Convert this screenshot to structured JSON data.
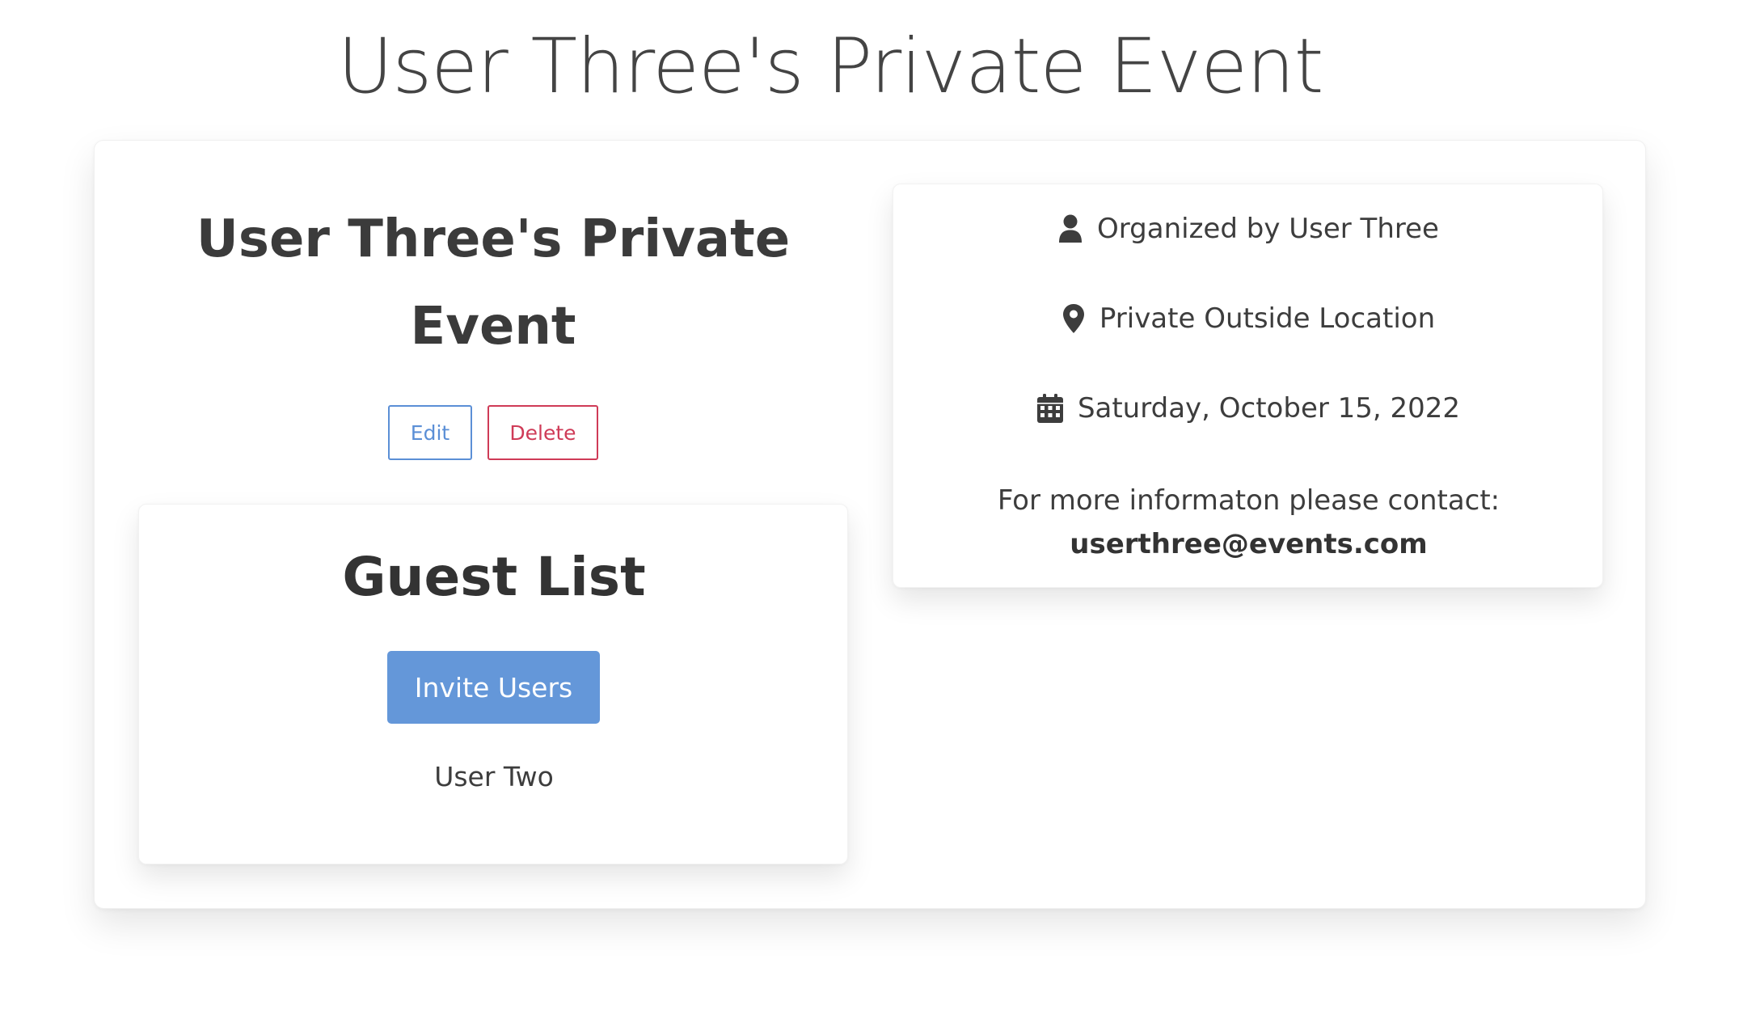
{
  "page": {
    "title": "User Three's Private Event"
  },
  "event": {
    "title": "User Three's Private Event",
    "edit_label": "Edit",
    "delete_label": "Delete"
  },
  "guest_list": {
    "heading": "Guest List",
    "invite_label": "Invite Users",
    "guests": [
      "User Two"
    ]
  },
  "details": {
    "organizer": "Organized by User Three",
    "organizer_icon": "user-icon",
    "location": "Private Outside Location",
    "location_icon": "map-marker-icon",
    "date": "Saturday, October 15, 2022",
    "date_icon": "calendar-icon",
    "contact_text": "For more informaton please contact:",
    "contact_email": "userthree@events.com"
  },
  "colors": {
    "primary": "#6497d9",
    "edit_outline": "#5b8fd6",
    "delete_outline": "#cf3b57",
    "text": "#3d3d3d"
  }
}
